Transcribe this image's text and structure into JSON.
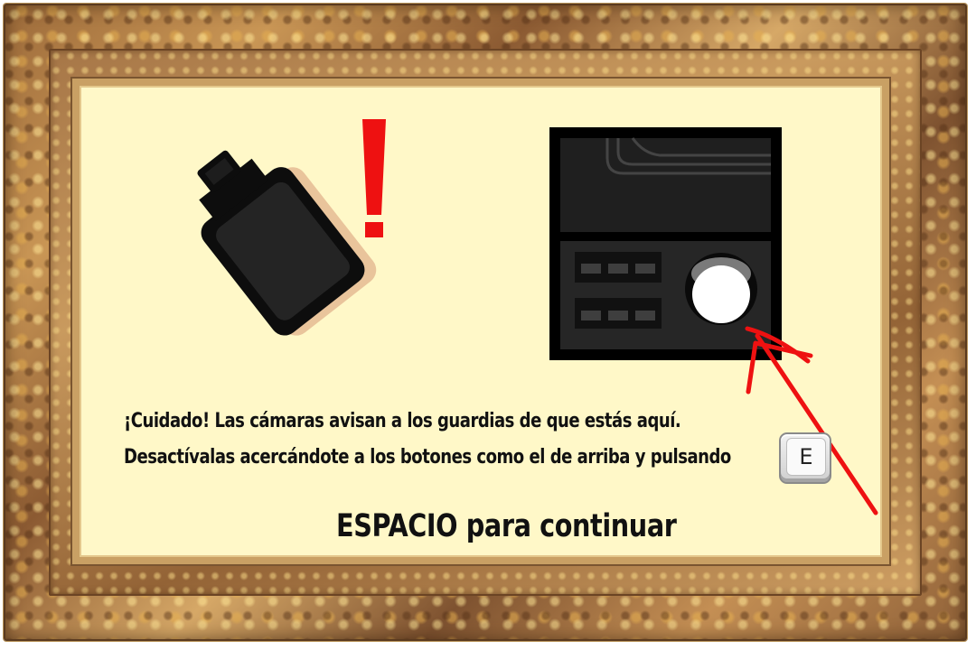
{
  "tutorial": {
    "message_line_1": "¡Cuidado! Las cámaras avisan a los guardias de que estás aquí.",
    "message_line_2": "Desactívalas acercándote a los botones como el de arriba y pulsando",
    "key_label": "E",
    "continue_prompt": "ESPACIO para continuar"
  },
  "icons": {
    "camera": "security-camera-icon",
    "alert": "exclamation-mark-icon",
    "control_panel": "camera-control-panel-icon",
    "button": "disable-button-icon",
    "arrow": "red-arrow-icon",
    "key": "keyboard-key-e-icon"
  },
  "colors": {
    "parchment": "#fff8c8",
    "frame_gold": "#c99655",
    "text": "#111111",
    "alert_red": "#ee1111",
    "panel_dark": "#1e1e1e"
  }
}
